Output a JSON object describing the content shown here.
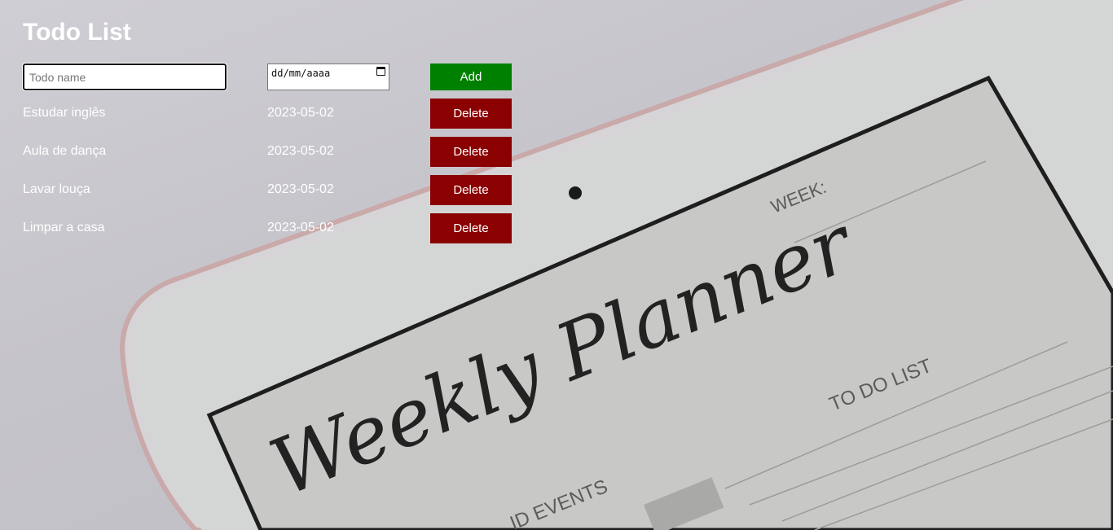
{
  "header": {
    "title": "Todo List"
  },
  "form": {
    "name_placeholder": "Todo name",
    "date_placeholder": "dd/mm/aaaa",
    "add_label": "Add"
  },
  "todos": [
    {
      "name": "Estudar inglês",
      "date": "2023-05-02",
      "delete_label": "Delete"
    },
    {
      "name": "Aula de dança",
      "date": "2023-05-02",
      "delete_label": "Delete"
    },
    {
      "name": "Lavar louça",
      "date": "2023-05-02",
      "delete_label": "Delete"
    },
    {
      "name": "Limpar a casa",
      "date": "2023-05-02",
      "delete_label": "Delete"
    }
  ],
  "background": {
    "week_label": "WEEK:",
    "title_line": "Weekly Planner",
    "todo_heading": "TO DO LIST",
    "events_heading": "ID EVENTS"
  },
  "colors": {
    "add_button": "#008000",
    "delete_button": "#8b0000",
    "text": "#ffffff"
  }
}
